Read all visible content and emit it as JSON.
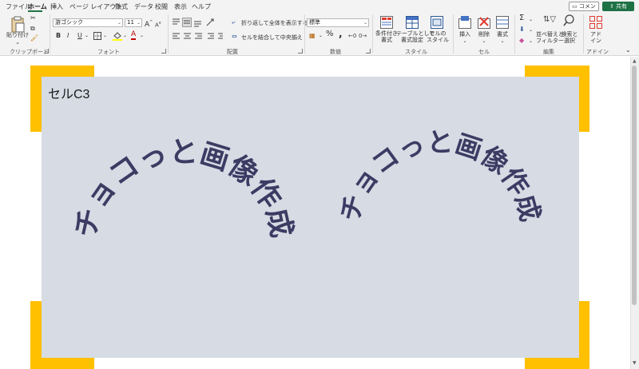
{
  "menu": {
    "tabs": [
      "ファイル",
      "ホーム",
      "挿入",
      "ページ レイアウト",
      "数式",
      "データ",
      "校閲",
      "表示",
      "ヘルプ"
    ],
    "active_tab": "ホーム",
    "comment_label": "コメント",
    "share_label": "共有"
  },
  "ribbon": {
    "clipboard": {
      "paste_label": "貼り付け",
      "group_label": "クリップボード"
    },
    "font": {
      "font_name": "游ゴシック",
      "font_size": "11",
      "bold": "B",
      "italic": "I",
      "underline": "U",
      "grow": "A",
      "shrink": "A",
      "font_color": "A",
      "group_label": "フォント"
    },
    "alignment": {
      "wrap_text": "折り返して全体を表示する",
      "merge_center": "セルを結合して中央揃え",
      "group_label": "配置"
    },
    "number": {
      "format": "標準",
      "percent": "%",
      "comma": ",",
      "group_label": "数値"
    },
    "styles": {
      "conditional": [
        "条件付き",
        "書式"
      ],
      "table": [
        "テーブルとして",
        "書式設定"
      ],
      "cell_styles": [
        "セルの",
        "スタイル"
      ],
      "group_label": "スタイル"
    },
    "cells": {
      "insert": "挿入",
      "delete": "削除",
      "format": "書式",
      "group_label": "セル"
    },
    "editing": {
      "sort_filter": [
        "並べ替えと",
        "フィルター"
      ],
      "find_select": [
        "検索と",
        "選択"
      ],
      "sigma": "Σ",
      "group_label": "編集"
    },
    "addins": {
      "label": [
        "アド",
        "イン"
      ],
      "group_label": "アドイン"
    }
  },
  "sheet": {
    "cell_label": "セルC3",
    "arc_texts": [
      "チョコっと画像作成",
      "チョコっと画像作成"
    ]
  },
  "colors": {
    "accent": "#ffc000",
    "panel": "#d6dbe4",
    "arc_text": "#3b3b63",
    "share": "#1e7145"
  },
  "icons": [
    "paste-icon",
    "cut-icon",
    "copy-icon",
    "format-painter-icon",
    "border-icon",
    "fill-color-icon",
    "conditional-format-icon",
    "table-format-icon",
    "cell-styles-icon",
    "insert-cells-icon",
    "delete-cells-icon",
    "format-cells-icon",
    "sort-filter-icon",
    "find-select-icon",
    "addins-icon",
    "scroll-up-icon",
    "scroll-down-icon"
  ]
}
